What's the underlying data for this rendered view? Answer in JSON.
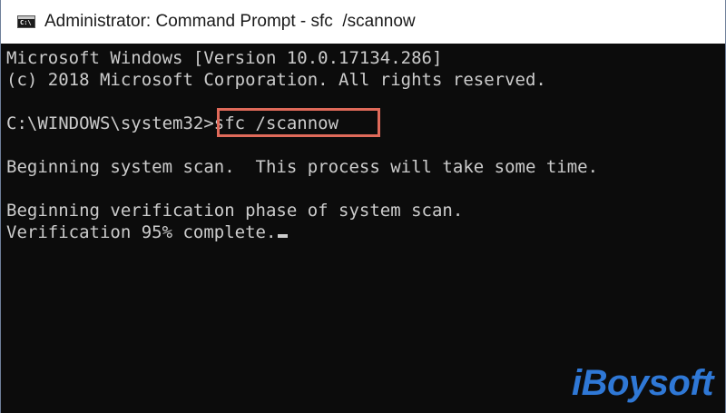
{
  "window": {
    "title": "Administrator: Command Prompt - sfc  /scannow",
    "icon": "cmd-icon",
    "icon_glyph": "C:\\"
  },
  "console": {
    "lines": [
      "Microsoft Windows [Version 10.0.17134.286]",
      "(c) 2018 Microsoft Corporation. All rights reserved.",
      "",
      "C:\\WINDOWS\\system32>",
      "",
      "Beginning system scan.  This process will take some time.",
      "",
      "Beginning verification phase of system scan.",
      "Verification 95% complete."
    ],
    "command": "sfc /scannow",
    "highlight_color": "#e06a5a"
  },
  "watermark": "iBoysoft",
  "colors": {
    "console_bg": "#0c0c0c",
    "console_text": "#cccccc",
    "watermark": "#2f78d6"
  }
}
